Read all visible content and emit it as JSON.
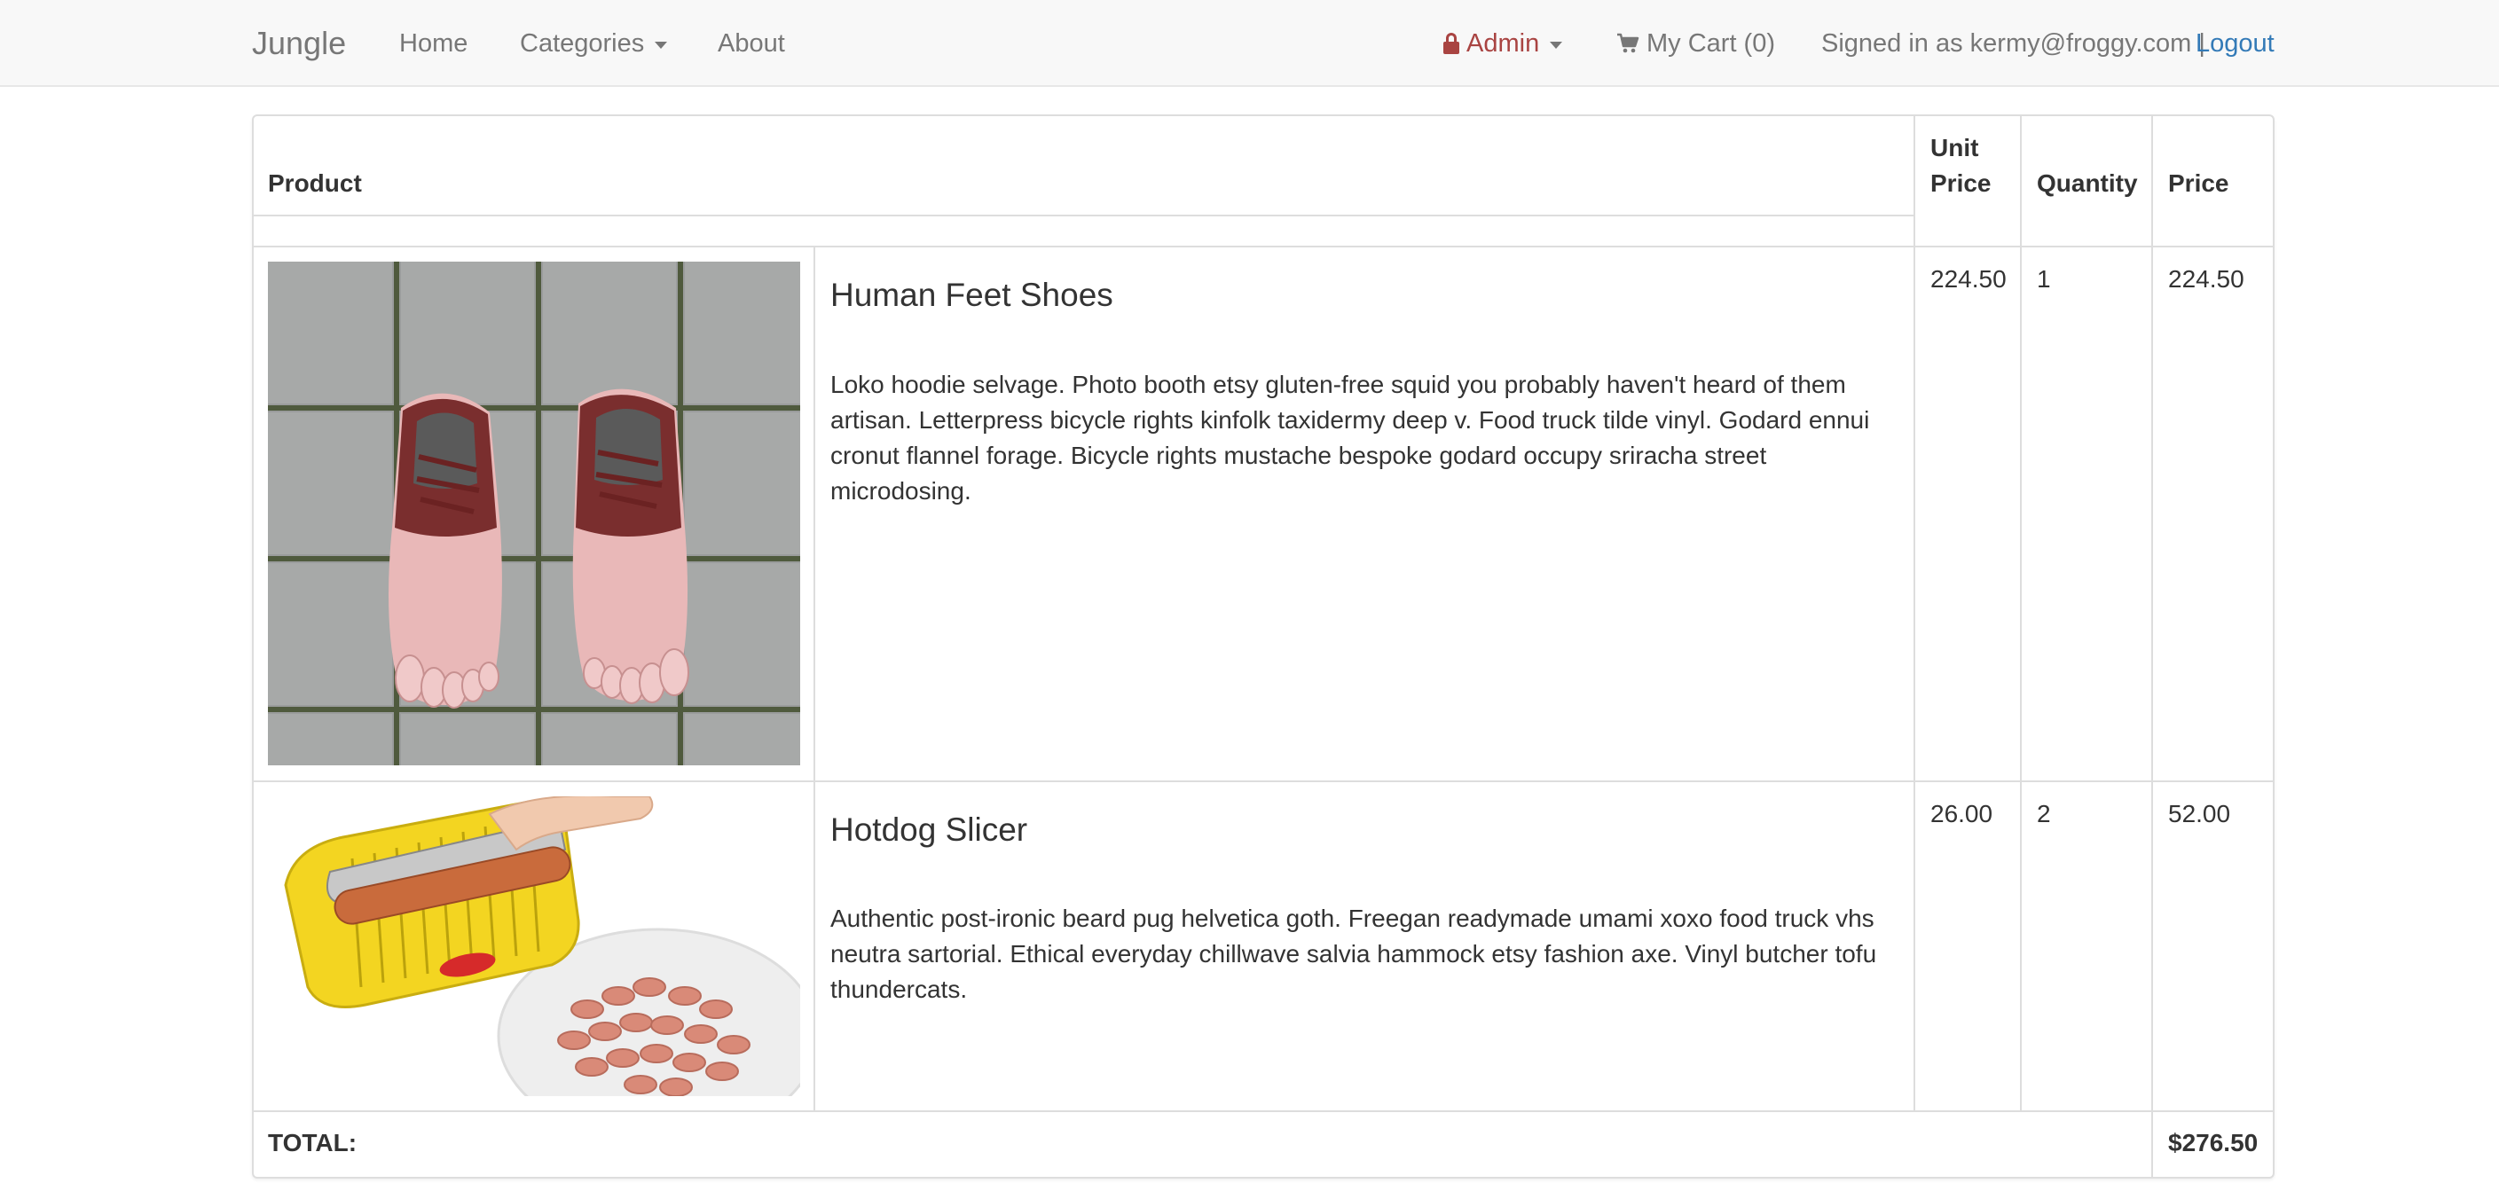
{
  "navbar": {
    "brand": "Jungle",
    "home": "Home",
    "categories": "Categories",
    "about": "About",
    "admin": "Admin",
    "cart": "My Cart (0)",
    "signed_in": "Signed in as kermy@froggy.com |",
    "logout": "Logout"
  },
  "table": {
    "headers": {
      "product": "Product",
      "unit_price_line1": "Unit",
      "unit_price_line2": "Price",
      "quantity": "Quantity",
      "price": "Price"
    },
    "rows": [
      {
        "name": "Human Feet Shoes",
        "description": "Loko hoodie selvage. Photo booth etsy gluten-free squid you probably haven't heard of them artisan. Letterpress bicycle rights kinfolk taxidermy deep v. Food truck tilde vinyl. Godard ennui cronut flannel forage. Bicycle rights mustache bespoke godard occupy sriracha street microdosing.",
        "unit_price": "224.50",
        "quantity": "1",
        "price": "224.50"
      },
      {
        "name": "Hotdog Slicer",
        "description": "Authentic post-ironic beard pug helvetica goth. Freegan readymade umami xoxo food truck vhs neutra sartorial. Ethical everyday chillwave salvia hammock etsy fashion axe. Vinyl butcher tofu thundercats.",
        "unit_price": "26.00",
        "quantity": "2",
        "price": "52.00"
      }
    ],
    "total_label": "TOTAL:",
    "total_value": "$276.50"
  },
  "colors": {
    "navbar_bg": "#f8f8f8",
    "link": "#337ab7",
    "admin": "#a94442"
  }
}
